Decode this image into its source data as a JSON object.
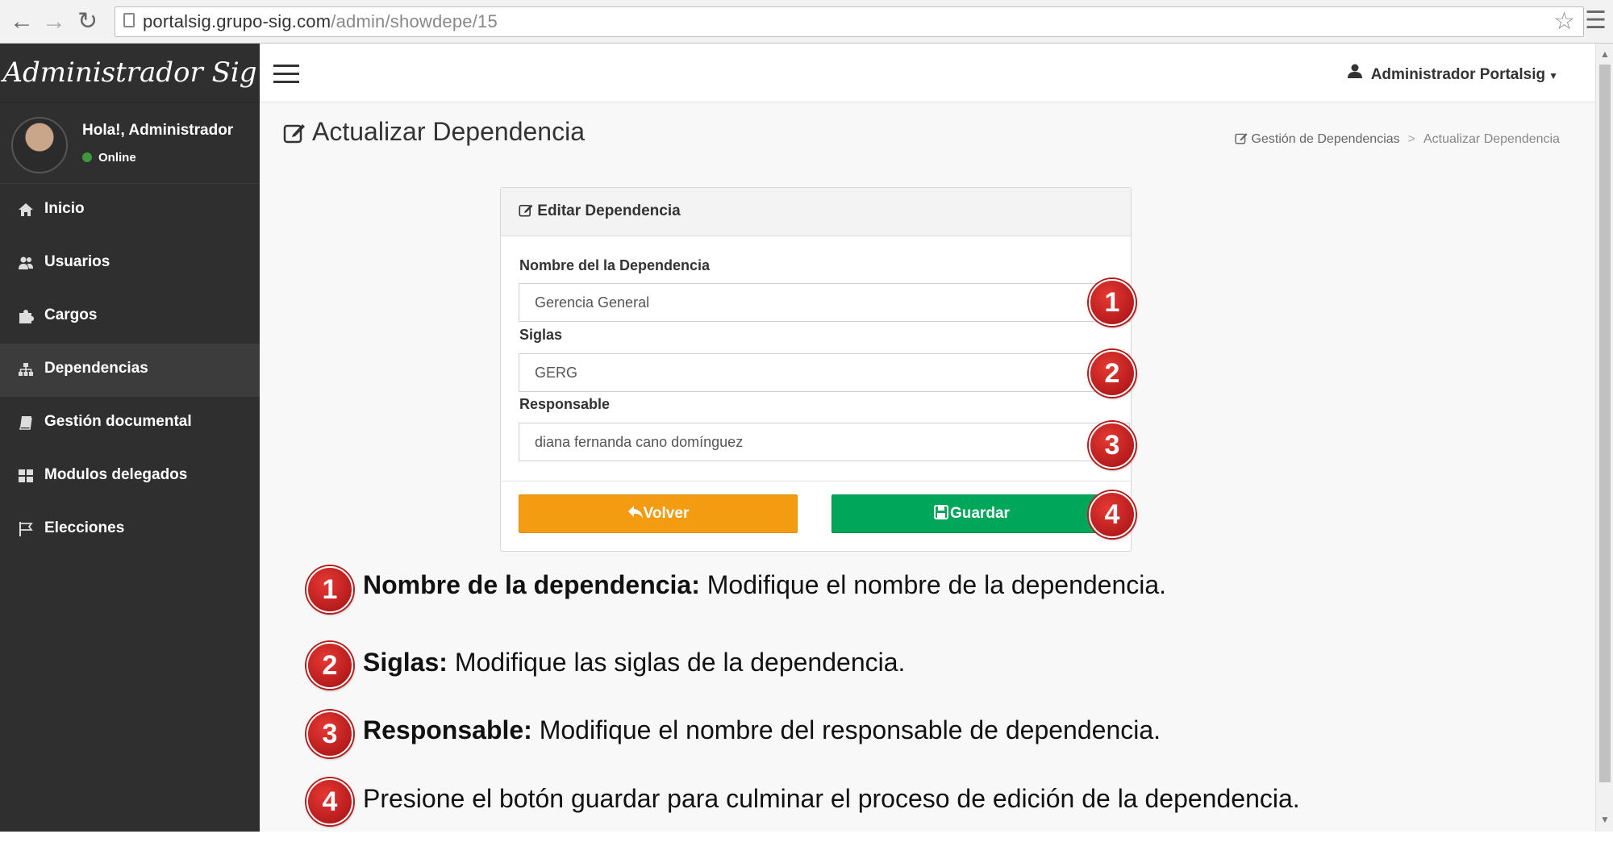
{
  "browser": {
    "url_host": "portalsig.grupo-sig.com",
    "url_path": "/admin/showdepe/15"
  },
  "sidebar": {
    "brand": "Administrador Sig",
    "user_greeting": "Hola!, Administrador",
    "user_status": "Online",
    "items": [
      {
        "label": "Inicio",
        "icon": "home-icon"
      },
      {
        "label": "Usuarios",
        "icon": "users-icon"
      },
      {
        "label": "Cargos",
        "icon": "puzzle-icon"
      },
      {
        "label": "Dependencias",
        "icon": "sitemap-icon"
      },
      {
        "label": "Gestión documental",
        "icon": "book-icon"
      },
      {
        "label": "Modulos delegados",
        "icon": "grid-icon"
      },
      {
        "label": "Elecciones",
        "icon": "flag-icon"
      }
    ],
    "active_index": 3
  },
  "header": {
    "user_menu": "Administrador Portalsig"
  },
  "page": {
    "title": "Actualizar Dependencia",
    "breadcrumb": [
      "Gestión de Dependencias",
      "Actualizar Dependencia"
    ]
  },
  "form": {
    "box_title": "Editar Dependencia",
    "fields": [
      {
        "label": "Nombre del la Dependencia",
        "value": "Gerencia General"
      },
      {
        "label": "Siglas",
        "value": "GERG"
      },
      {
        "label": "Responsable",
        "value": "diana fernanda cano domínguez"
      }
    ],
    "back_label": "Volver",
    "save_label": "Guardar"
  },
  "badges": [
    "1",
    "2",
    "3",
    "4"
  ],
  "notes": [
    {
      "num": "1",
      "bold": "Nombre de la dependencia:",
      "text": " Modifique el nombre de la dependencia."
    },
    {
      "num": "2",
      "bold": "Siglas:",
      "text": " Modifique las siglas de la dependencia."
    },
    {
      "num": "3",
      "bold": "Responsable:",
      "text": " Modifique el nombre del responsable de dependencia."
    },
    {
      "num": "4",
      "bold": "",
      "text": "Presione el botón guardar para culminar el proceso de edición de la dependencia."
    }
  ],
  "colors": {
    "sidebar_bg": "#2f2f2f",
    "back_button": "#f39c12",
    "save_button": "#00a65a",
    "badge": "#c62828"
  }
}
